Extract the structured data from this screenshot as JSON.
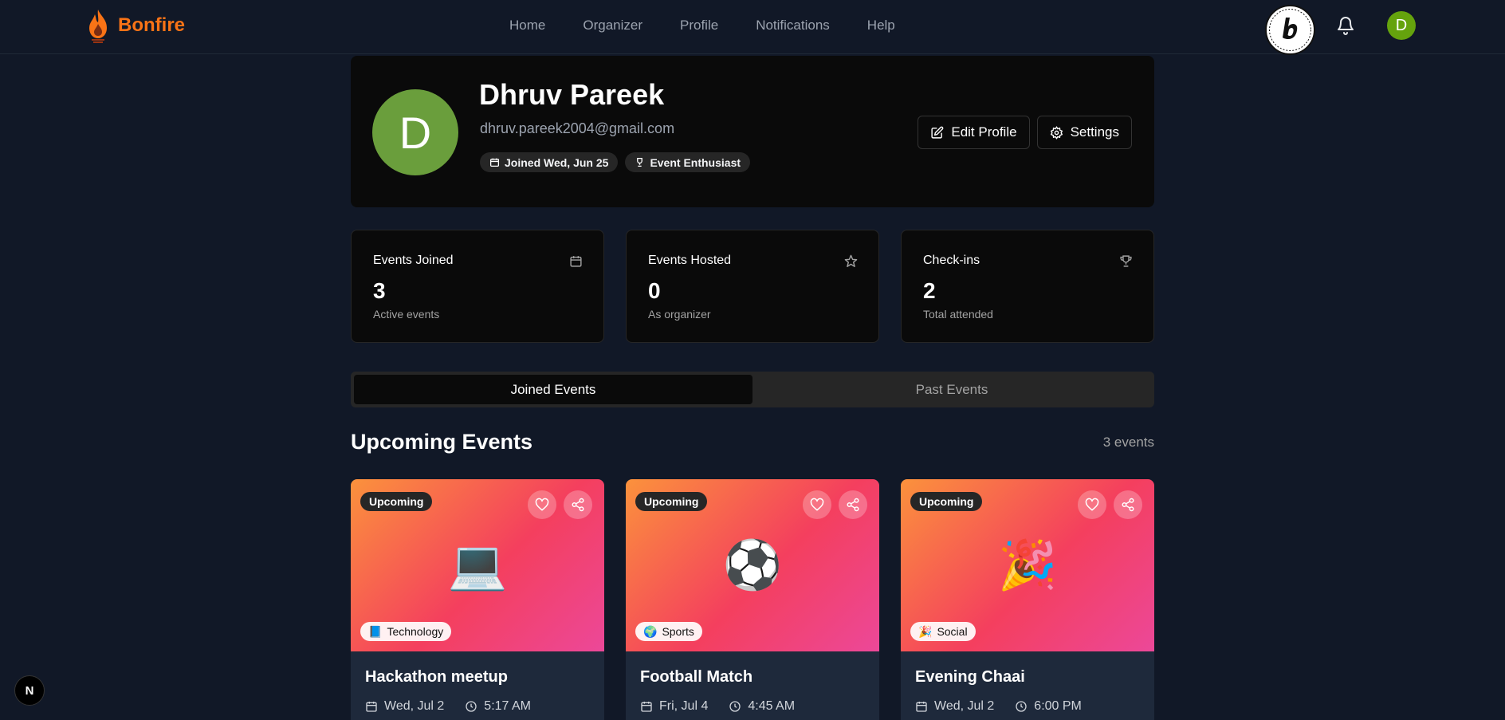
{
  "brand": {
    "name": "Bonfire",
    "logo_icon": "flame-icon"
  },
  "nav": {
    "items": [
      {
        "label": "Home"
      },
      {
        "label": "Organizer"
      },
      {
        "label": "Profile"
      },
      {
        "label": "Notifications"
      },
      {
        "label": "Help"
      }
    ],
    "avatar_initial": "D"
  },
  "profile": {
    "initial": "D",
    "name": "Dhruv Pareek",
    "email": "dhruv.pareek2004@gmail.com",
    "joined": "Joined Wed, Jun 25",
    "badge": "Event Enthusiast",
    "edit_label": "Edit Profile",
    "settings_label": "Settings"
  },
  "stats": [
    {
      "label": "Events Joined",
      "value": "3",
      "sub": "Active events",
      "icon": "calendar-icon"
    },
    {
      "label": "Events Hosted",
      "value": "0",
      "sub": "As organizer",
      "icon": "star-icon"
    },
    {
      "label": "Check-ins",
      "value": "2",
      "sub": "Total attended",
      "icon": "trophy-icon"
    }
  ],
  "tabs": [
    {
      "label": "Joined Events",
      "active": true
    },
    {
      "label": "Past Events",
      "active": false
    }
  ],
  "section": {
    "title": "Upcoming Events",
    "count": "3 events"
  },
  "events": [
    {
      "status": "Upcoming",
      "emoji": "💻",
      "category_emoji": "📘",
      "category": "Technology",
      "title": "Hackathon meetup",
      "date": "Wed, Jul 2",
      "time": "5:17 AM"
    },
    {
      "status": "Upcoming",
      "emoji": "⚽",
      "category_emoji": "🌍",
      "category": "Sports",
      "title": "Football Match",
      "date": "Fri, Jul 4",
      "time": "4:45 AM"
    },
    {
      "status": "Upcoming",
      "emoji": "🎉",
      "category_emoji": "🎉",
      "category": "Social",
      "title": "Evening Chaai",
      "date": "Wed, Jul 2",
      "time": "6:00 PM"
    }
  ],
  "dev_badge": "N",
  "colors": {
    "background": "#111827",
    "brand": "#f97316",
    "avatar": "#65a30d",
    "card": "#0a0a0a"
  }
}
